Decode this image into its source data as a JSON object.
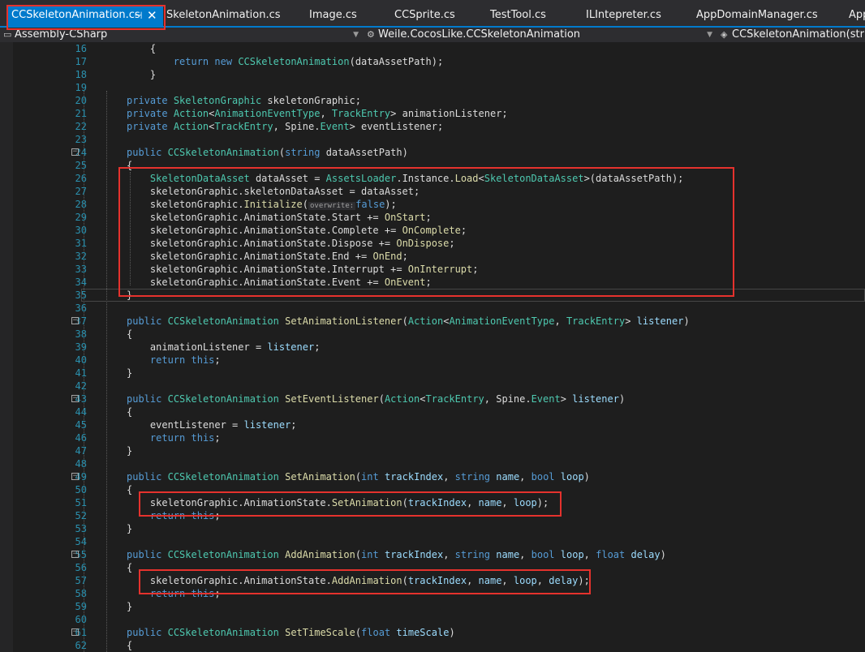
{
  "tabs": [
    {
      "label": "CCSkeletonAnimation.cs",
      "active": true
    },
    {
      "label": "SkeletonAnimation.cs"
    },
    {
      "label": "Image.cs"
    },
    {
      "label": "CCSprite.cs"
    },
    {
      "label": "TestTool.cs"
    },
    {
      "label": "ILIntepreter.cs"
    },
    {
      "label": "AppDomainManager.cs"
    },
    {
      "label": "App"
    }
  ],
  "tab_pin": "⊣",
  "tab_close": "✕",
  "nav": {
    "project": "Assembly-CSharp",
    "type": "Weile.CocosLike.CCSkeletonAnimation",
    "member": "CCSkeletonAnimation(string"
  },
  "colors": {
    "accent": "#007acc",
    "highlight": "#e5322d"
  },
  "inline_hint": "overwrite:",
  "code_lines": [
    {
      "n": "16",
      "seg": [
        [
          "    {",
          ""
        ]
      ]
    },
    {
      "n": "17",
      "seg": [
        [
          "        ",
          ""
        ],
        [
          "return",
          "k"
        ],
        [
          " ",
          ""
        ],
        [
          "new",
          "k"
        ],
        [
          " ",
          ""
        ],
        [
          "CCSkeletonAnimation",
          "t"
        ],
        [
          "(dataAssetPath);",
          ""
        ]
      ]
    },
    {
      "n": "18",
      "seg": [
        [
          "    }",
          ""
        ]
      ]
    },
    {
      "n": "19",
      "seg": []
    },
    {
      "n": "20",
      "seg": [
        [
          "private",
          "k"
        ],
        [
          " ",
          ""
        ],
        [
          "SkeletonGraphic",
          "t"
        ],
        [
          " skeletonGraphic;",
          ""
        ]
      ]
    },
    {
      "n": "21",
      "seg": [
        [
          "private",
          "k"
        ],
        [
          " ",
          ""
        ],
        [
          "Action",
          "t"
        ],
        [
          "<",
          ""
        ],
        [
          "AnimationEventType",
          "t"
        ],
        [
          ", ",
          ""
        ],
        [
          "TrackEntry",
          "t"
        ],
        [
          "> animationListener;",
          ""
        ]
      ]
    },
    {
      "n": "22",
      "seg": [
        [
          "private",
          "k"
        ],
        [
          " ",
          ""
        ],
        [
          "Action",
          "t"
        ],
        [
          "<",
          ""
        ],
        [
          "TrackEntry",
          "t"
        ],
        [
          ", Spine.",
          ""
        ],
        [
          "Event",
          "t"
        ],
        [
          "> eventListener;",
          ""
        ]
      ]
    },
    {
      "n": "23",
      "seg": []
    },
    {
      "n": "24",
      "seg": [
        [
          "public",
          "k"
        ],
        [
          " ",
          ""
        ],
        [
          "CCSkeletonAnimation",
          "t"
        ],
        [
          "(",
          ""
        ],
        [
          "string",
          "k"
        ],
        [
          " dataAssetPath)",
          ""
        ]
      ]
    },
    {
      "n": "25",
      "seg": [
        [
          "{",
          ""
        ]
      ]
    },
    {
      "n": "26",
      "seg": [
        [
          "    ",
          ""
        ],
        [
          "SkeletonDataAsset",
          "t"
        ],
        [
          " dataAsset = ",
          ""
        ],
        [
          "AssetsLoader",
          "t"
        ],
        [
          ".Instance.",
          ""
        ],
        [
          "Load",
          "f"
        ],
        [
          "<",
          ""
        ],
        [
          "SkeletonDataAsset",
          "t"
        ],
        [
          ">(dataAssetPath);",
          ""
        ]
      ]
    },
    {
      "n": "27",
      "seg": [
        [
          "    skeletonGraphic.skeletonDataAsset = dataAsset;",
          ""
        ]
      ]
    },
    {
      "n": "28",
      "seg": [
        [
          "    skeletonGraphic.",
          ""
        ],
        [
          "Initialize",
          "f"
        ],
        [
          "(",
          ""
        ],
        [
          "HINT",
          "hint"
        ],
        [
          "false",
          "k"
        ],
        [
          ");",
          ""
        ]
      ]
    },
    {
      "n": "29",
      "seg": [
        [
          "    skeletonGraphic.AnimationState.Start += ",
          ""
        ],
        [
          "OnStart",
          "f"
        ],
        [
          ";",
          ""
        ]
      ]
    },
    {
      "n": "30",
      "seg": [
        [
          "    skeletonGraphic.AnimationState.Complete += ",
          ""
        ],
        [
          "OnComplete",
          "f"
        ],
        [
          ";",
          ""
        ]
      ]
    },
    {
      "n": "31",
      "seg": [
        [
          "    skeletonGraphic.AnimationState.Dispose += ",
          ""
        ],
        [
          "OnDispose",
          "f"
        ],
        [
          ";",
          ""
        ]
      ]
    },
    {
      "n": "32",
      "seg": [
        [
          "    skeletonGraphic.AnimationState.End += ",
          ""
        ],
        [
          "OnEnd",
          "f"
        ],
        [
          ";",
          ""
        ]
      ]
    },
    {
      "n": "33",
      "seg": [
        [
          "    skeletonGraphic.AnimationState.Interrupt += ",
          ""
        ],
        [
          "OnInterrupt",
          "f"
        ],
        [
          ";",
          ""
        ]
      ]
    },
    {
      "n": "34",
      "seg": [
        [
          "    skeletonGraphic.AnimationState.Event += ",
          ""
        ],
        [
          "OnEvent",
          "f"
        ],
        [
          ";",
          ""
        ]
      ]
    },
    {
      "n": "35",
      "seg": [
        [
          "}",
          ""
        ]
      ]
    },
    {
      "n": "36",
      "seg": []
    },
    {
      "n": "37",
      "seg": [
        [
          "public",
          "k"
        ],
        [
          " ",
          ""
        ],
        [
          "CCSkeletonAnimation",
          "t"
        ],
        [
          " ",
          ""
        ],
        [
          "SetAnimationListener",
          "f"
        ],
        [
          "(",
          ""
        ],
        [
          "Action",
          "t"
        ],
        [
          "<",
          ""
        ],
        [
          "AnimationEventType",
          "t"
        ],
        [
          ", ",
          ""
        ],
        [
          "TrackEntry",
          "t"
        ],
        [
          "> ",
          ""
        ],
        [
          "listener",
          "pn"
        ],
        [
          ")",
          ""
        ]
      ]
    },
    {
      "n": "38",
      "seg": [
        [
          "{",
          ""
        ]
      ]
    },
    {
      "n": "39",
      "seg": [
        [
          "    animationListener = ",
          ""
        ],
        [
          "listener",
          "pn"
        ],
        [
          ";",
          ""
        ]
      ]
    },
    {
      "n": "40",
      "seg": [
        [
          "    ",
          ""
        ],
        [
          "return",
          "k"
        ],
        [
          " ",
          ""
        ],
        [
          "this",
          "k"
        ],
        [
          ";",
          ""
        ]
      ]
    },
    {
      "n": "41",
      "seg": [
        [
          "}",
          ""
        ]
      ]
    },
    {
      "n": "42",
      "seg": []
    },
    {
      "n": "43",
      "seg": [
        [
          "public",
          "k"
        ],
        [
          " ",
          ""
        ],
        [
          "CCSkeletonAnimation",
          "t"
        ],
        [
          " ",
          ""
        ],
        [
          "SetEventListener",
          "f"
        ],
        [
          "(",
          ""
        ],
        [
          "Action",
          "t"
        ],
        [
          "<",
          ""
        ],
        [
          "TrackEntry",
          "t"
        ],
        [
          ", Spine.",
          ""
        ],
        [
          "Event",
          "t"
        ],
        [
          "> ",
          ""
        ],
        [
          "listener",
          "pn"
        ],
        [
          ")",
          ""
        ]
      ]
    },
    {
      "n": "44",
      "seg": [
        [
          "{",
          ""
        ]
      ]
    },
    {
      "n": "45",
      "seg": [
        [
          "    eventListener = ",
          ""
        ],
        [
          "listener",
          "pn"
        ],
        [
          ";",
          ""
        ]
      ]
    },
    {
      "n": "46",
      "seg": [
        [
          "    ",
          ""
        ],
        [
          "return",
          "k"
        ],
        [
          " ",
          ""
        ],
        [
          "this",
          "k"
        ],
        [
          ";",
          ""
        ]
      ]
    },
    {
      "n": "47",
      "seg": [
        [
          "}",
          ""
        ]
      ]
    },
    {
      "n": "48",
      "seg": []
    },
    {
      "n": "49",
      "seg": [
        [
          "public",
          "k"
        ],
        [
          " ",
          ""
        ],
        [
          "CCSkeletonAnimation",
          "t"
        ],
        [
          " ",
          ""
        ],
        [
          "SetAnimation",
          "f"
        ],
        [
          "(",
          ""
        ],
        [
          "int",
          "k"
        ],
        [
          " ",
          ""
        ],
        [
          "trackIndex",
          "pn"
        ],
        [
          ", ",
          ""
        ],
        [
          "string",
          "k"
        ],
        [
          " ",
          ""
        ],
        [
          "name",
          "pn"
        ],
        [
          ", ",
          ""
        ],
        [
          "bool",
          "k"
        ],
        [
          " ",
          ""
        ],
        [
          "loop",
          "pn"
        ],
        [
          ")",
          ""
        ]
      ]
    },
    {
      "n": "50",
      "seg": [
        [
          "{",
          ""
        ]
      ]
    },
    {
      "n": "51",
      "seg": [
        [
          "    skeletonGraphic.AnimationState.",
          ""
        ],
        [
          "SetAnimation",
          "f"
        ],
        [
          "(",
          ""
        ],
        [
          "trackIndex",
          "pn"
        ],
        [
          ", ",
          ""
        ],
        [
          "name",
          "pn"
        ],
        [
          ", ",
          ""
        ],
        [
          "loop",
          "pn"
        ],
        [
          ");",
          ""
        ]
      ]
    },
    {
      "n": "52",
      "seg": [
        [
          "    ",
          ""
        ],
        [
          "return",
          "k"
        ],
        [
          " ",
          ""
        ],
        [
          "this",
          "k"
        ],
        [
          ";",
          ""
        ]
      ]
    },
    {
      "n": "53",
      "seg": [
        [
          "}",
          ""
        ]
      ]
    },
    {
      "n": "54",
      "seg": []
    },
    {
      "n": "55",
      "seg": [
        [
          "public",
          "k"
        ],
        [
          " ",
          ""
        ],
        [
          "CCSkeletonAnimation",
          "t"
        ],
        [
          " ",
          ""
        ],
        [
          "AddAnimation",
          "f"
        ],
        [
          "(",
          ""
        ],
        [
          "int",
          "k"
        ],
        [
          " ",
          ""
        ],
        [
          "trackIndex",
          "pn"
        ],
        [
          ", ",
          ""
        ],
        [
          "string",
          "k"
        ],
        [
          " ",
          ""
        ],
        [
          "name",
          "pn"
        ],
        [
          ", ",
          ""
        ],
        [
          "bool",
          "k"
        ],
        [
          " ",
          ""
        ],
        [
          "loop",
          "pn"
        ],
        [
          ", ",
          ""
        ],
        [
          "float",
          "k"
        ],
        [
          " ",
          ""
        ],
        [
          "delay",
          "pn"
        ],
        [
          ")",
          ""
        ]
      ]
    },
    {
      "n": "56",
      "seg": [
        [
          "{",
          ""
        ]
      ]
    },
    {
      "n": "57",
      "seg": [
        [
          "    skeletonGraphic.AnimationState.",
          ""
        ],
        [
          "AddAnimation",
          "f"
        ],
        [
          "(",
          ""
        ],
        [
          "trackIndex",
          "pn"
        ],
        [
          ", ",
          ""
        ],
        [
          "name",
          "pn"
        ],
        [
          ", ",
          ""
        ],
        [
          "loop",
          "pn"
        ],
        [
          ", ",
          ""
        ],
        [
          "delay",
          "pn"
        ],
        [
          ");",
          ""
        ]
      ]
    },
    {
      "n": "58",
      "seg": [
        [
          "    ",
          ""
        ],
        [
          "return",
          "k"
        ],
        [
          " ",
          ""
        ],
        [
          "this",
          "k"
        ],
        [
          ";",
          ""
        ]
      ]
    },
    {
      "n": "59",
      "seg": [
        [
          "}",
          ""
        ]
      ]
    },
    {
      "n": "60",
      "seg": []
    },
    {
      "n": "61",
      "seg": [
        [
          "public",
          "k"
        ],
        [
          " ",
          ""
        ],
        [
          "CCSkeletonAnimation",
          "t"
        ],
        [
          " ",
          ""
        ],
        [
          "SetTimeScale",
          "f"
        ],
        [
          "(",
          ""
        ],
        [
          "float",
          "k"
        ],
        [
          " ",
          ""
        ],
        [
          "timeScale",
          "pn"
        ],
        [
          ")",
          ""
        ]
      ]
    },
    {
      "n": "62",
      "seg": [
        [
          "{",
          ""
        ]
      ]
    }
  ],
  "folds": [
    "24",
    "37",
    "43",
    "49",
    "55",
    "61"
  ]
}
